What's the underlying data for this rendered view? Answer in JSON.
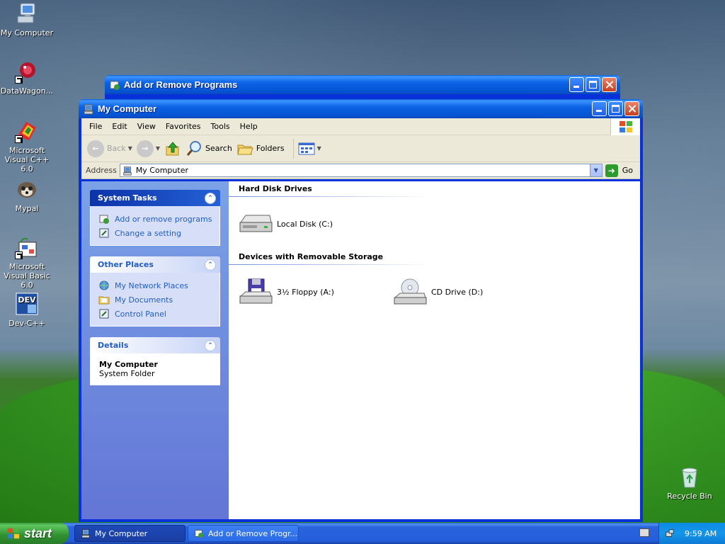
{
  "desktop": {
    "icons": [
      {
        "label": "My Computer",
        "icon": "my-computer-icon"
      },
      {
        "label": "DataWagon...",
        "icon": "datawagon-icon"
      },
      {
        "label": "Microsoft Visual C++ 6.0",
        "icon": "visual-cpp-icon"
      },
      {
        "label": "Mypal",
        "icon": "mypal-icon"
      },
      {
        "label": "Microsoft Visual Basic 6.0",
        "icon": "visual-basic-icon"
      },
      {
        "label": "Dev-C++",
        "icon": "dev-cpp-icon"
      },
      {
        "label": "Recycle Bin",
        "icon": "recycle-bin-icon"
      }
    ],
    "dev_badge": "DEV"
  },
  "back_window": {
    "title": "Add or Remove Programs"
  },
  "window": {
    "title": "My Computer",
    "menu": [
      "File",
      "Edit",
      "View",
      "Favorites",
      "Tools",
      "Help"
    ],
    "toolbar": {
      "back": "Back",
      "search": "Search",
      "folders": "Folders"
    },
    "address": {
      "label": "Address",
      "value": "My Computer",
      "go": "Go"
    },
    "task_pane": {
      "system_tasks": {
        "title": "System Tasks",
        "items": [
          "Add or remove programs",
          "Change a setting"
        ]
      },
      "other_places": {
        "title": "Other Places",
        "items": [
          "My Network Places",
          "My Documents",
          "Control Panel"
        ]
      },
      "details": {
        "title": "Details",
        "name": "My Computer",
        "type": "System Folder"
      }
    },
    "groups": [
      {
        "title": "Hard Disk Drives",
        "items": [
          {
            "label": "Local Disk (C:)"
          }
        ]
      },
      {
        "title": "Devices with Removable Storage",
        "items": [
          {
            "label": "3½ Floppy (A:)"
          },
          {
            "label": "CD Drive (D:)"
          }
        ]
      }
    ]
  },
  "taskbar": {
    "start": "start",
    "tasks": [
      "My Computer",
      "Add or Remove Progr..."
    ],
    "clock": "9:59 AM"
  },
  "colors": {
    "title_blue": "#0b63e5",
    "task_pane_blue": "#7ba2e7",
    "link_blue": "#215dc6",
    "start_green": "#3c9a3c"
  }
}
